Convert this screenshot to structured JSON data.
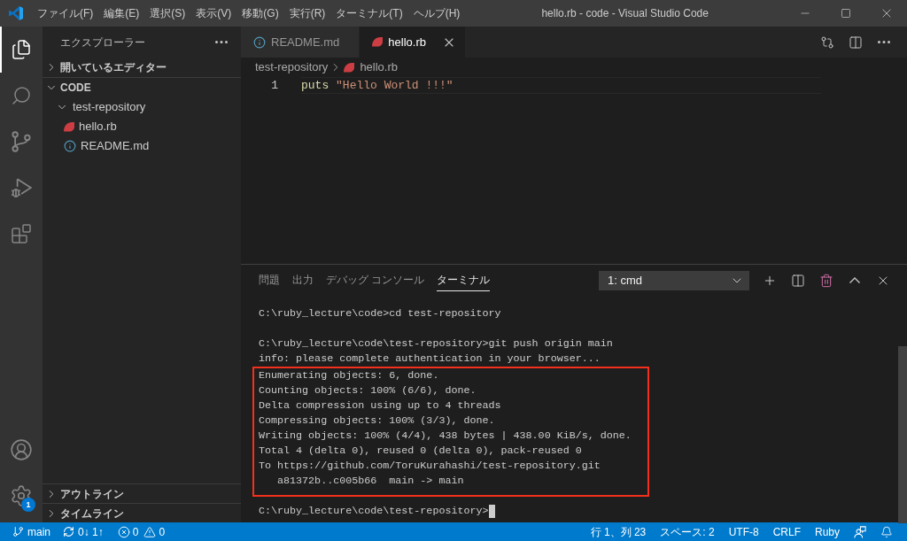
{
  "title_bar": {
    "menu": [
      "ファイル(F)",
      "編集(E)",
      "選択(S)",
      "表示(V)",
      "移動(G)",
      "実行(R)",
      "ターミナル(T)",
      "ヘルプ(H)"
    ],
    "title": "hello.rb - code - Visual Studio Code"
  },
  "activity_bar": {
    "top": [
      {
        "kind": "explorer",
        "selected": true
      },
      {
        "kind": "search",
        "selected": false
      },
      {
        "kind": "source-control",
        "selected": false
      },
      {
        "kind": "debug",
        "selected": false
      },
      {
        "kind": "extensions",
        "selected": false
      }
    ],
    "bottom": [
      {
        "kind": "account"
      },
      {
        "kind": "settings",
        "badge": "1"
      }
    ]
  },
  "sidebar": {
    "title": "エクスプローラー",
    "sections": [
      {
        "label": "開いているエディター",
        "expanded": false
      },
      {
        "label": "CODE",
        "expanded": true,
        "tree": [
          {
            "label": "test-repository",
            "expanded": true,
            "children": [
              {
                "label": "hello.rb",
                "kind": "ruby"
              },
              {
                "label": "README.md",
                "kind": "info"
              }
            ]
          }
        ]
      }
    ],
    "bottom_sections": [
      {
        "label": "アウトライン",
        "expanded": false
      },
      {
        "label": "タイムライン",
        "expanded": false
      }
    ]
  },
  "editor": {
    "tabs": [
      {
        "label": "README.md",
        "kind": "info",
        "selected": false
      },
      {
        "label": "hello.rb",
        "kind": "ruby",
        "selected": true
      }
    ],
    "breadcrumb": [
      {
        "label": "test-repository"
      },
      {
        "label": "hello.rb",
        "kind": "ruby"
      }
    ],
    "lines": [
      {
        "number": "1",
        "tokens": [
          {
            "text": "puts",
            "kind": "function"
          },
          {
            "text": "\"Hello World !!!\"",
            "kind": "string"
          }
        ]
      }
    ]
  },
  "panel": {
    "tabs": [
      {
        "label": "問題",
        "selected": false
      },
      {
        "label": "出力",
        "selected": false
      },
      {
        "label": "デバッグ コンソール",
        "selected": false
      },
      {
        "label": "ターミナル",
        "selected": true
      }
    ],
    "terminal_select": {
      "value": "1: cmd"
    },
    "terminal": {
      "blocks": [
        {
          "lines": [
            "C:\\ruby_lecture\\code>cd test-repository"
          ]
        },
        {
          "lines": [
            "C:\\ruby_lecture\\code\\test-repository>git push origin main",
            "info: please complete authentication in your browser..."
          ],
          "framed_lines": [
            "Enumerating objects: 6, done.",
            "Counting objects: 100% (6/6), done.",
            "Delta compression using up to 4 threads",
            "Compressing objects: 100% (3/3), done.",
            "Writing objects: 100% (4/4), 438 bytes | 438.00 KiB/s, done.",
            "Total 4 (delta 0), reused 0 (delta 0), pack-reused 0",
            "To https://github.com/ToruKurahashi/test-repository.git",
            "   a81372b..c005b66  main -> main"
          ]
        },
        {
          "lines": [
            "C:\\ruby_lecture\\code\\test-repository>"
          ]
        }
      ],
      "cursor": true
    }
  },
  "status_bar": {
    "left": [
      {
        "kind": "branch",
        "label": "main"
      },
      {
        "kind": "sync",
        "label": "0↓ 1↑"
      },
      {
        "kind": "problems",
        "errors": "0",
        "warnings": "0"
      }
    ],
    "right": [
      {
        "kind": "text",
        "label": "行 1、列 23"
      },
      {
        "kind": "text",
        "label": "スペース: 2"
      },
      {
        "kind": "text",
        "label": "UTF-8"
      },
      {
        "kind": "text",
        "label": "CRLF"
      },
      {
        "kind": "text",
        "label": "Ruby"
      },
      {
        "kind": "feedback"
      },
      {
        "kind": "bell"
      }
    ]
  }
}
